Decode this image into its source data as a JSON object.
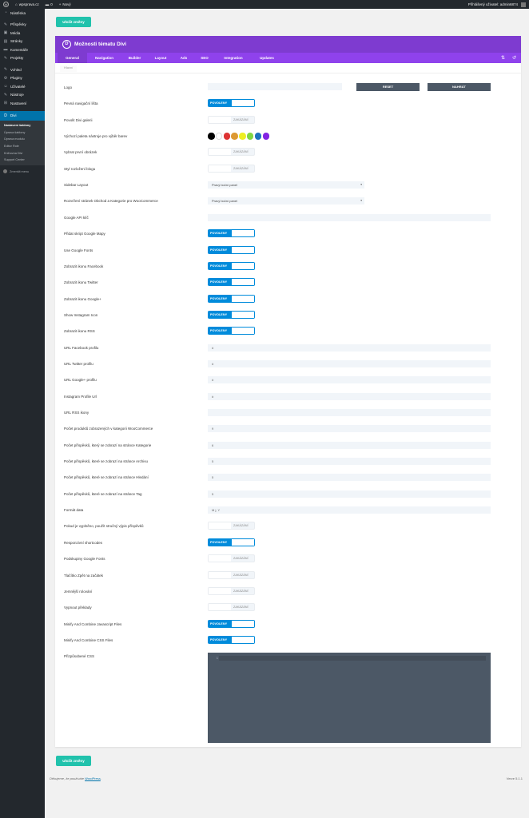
{
  "adminbar": {
    "wp_logo": "W",
    "site": "wpsprava.cz",
    "comments_count": "0",
    "new_label": "Nový",
    "greeting": "Přihlášený uživatel: admin6874"
  },
  "sidebar": {
    "menu_group1": [
      {
        "icon": "dashboard-icon",
        "glyph": "◔",
        "label": "Nástěnka"
      }
    ],
    "menu_group2": [
      {
        "icon": "pin-icon",
        "glyph": "✎",
        "label": "Příspěvky"
      },
      {
        "icon": "media-icon",
        "glyph": "▣",
        "label": "Média"
      },
      {
        "icon": "pages-icon",
        "glyph": "▤",
        "label": "Stránky"
      },
      {
        "icon": "comments-icon",
        "glyph": "▬",
        "label": "Komentáře"
      },
      {
        "icon": "projects-icon",
        "glyph": "✎",
        "label": "Projekty"
      }
    ],
    "menu_group3": [
      {
        "icon": "appearance-icon",
        "glyph": "✎",
        "label": "Vzhled"
      },
      {
        "icon": "plugins-icon",
        "glyph": "⚙",
        "label": "Pluginy"
      },
      {
        "icon": "users-icon",
        "glyph": "☺",
        "label": "Uživatelé"
      },
      {
        "icon": "tools-icon",
        "glyph": "✎",
        "label": "Nástroje"
      },
      {
        "icon": "settings-icon",
        "glyph": "⊞",
        "label": "Nastavení"
      }
    ],
    "divi": {
      "glyph": "D",
      "label": "Divi"
    },
    "submenu": [
      "Nastavení šablony",
      "Úprava šablony",
      "Úprava modulu",
      "Editor Role",
      "Knihovna Divi",
      "Support Center"
    ],
    "collapse": "Zmenšit menu"
  },
  "save_label": "Uložit změny",
  "panel": {
    "logo_letter": "D",
    "title": "Možnosti tématu Divi",
    "tabs": [
      {
        "label": "General",
        "width": 37
      },
      {
        "label": "Navigation",
        "width": 43
      },
      {
        "label": "Builder",
        "width": 33
      },
      {
        "label": "Layout",
        "width": 32
      },
      {
        "label": "Ads",
        "width": 26
      },
      {
        "label": "SEO",
        "width": 26
      },
      {
        "label": "Integration",
        "width": 46
      },
      {
        "label": "Updates",
        "width": 38
      }
    ],
    "tools": {
      "sort": "⇅",
      "reset": "↺"
    },
    "subtab": "Hlavní"
  },
  "toggle_on_label": "POVOLENY",
  "toggle_off_label": "ZAKÁZÁNÍ",
  "logo_row": {
    "label": "Logo",
    "reset": "RESET",
    "upload": "NAHRÁT"
  },
  "colors": [
    "#000000",
    "#ffffff",
    "#dd3333",
    "#dd9933",
    "#eeee22",
    "#81d742",
    "#1e73be",
    "#8224e3"
  ],
  "rows": [
    {
      "label": "Pevná navigační lišta",
      "type": "on"
    },
    {
      "label": "Povolit Divi galerii",
      "type": "off"
    },
    {
      "label": "Výchozí paleta nástroje pro výběr barev",
      "type": "colors"
    },
    {
      "label": "Vybrat první obrázek",
      "type": "off"
    },
    {
      "label": "Styl rozložení blogu",
      "type": "off"
    },
    {
      "label": "Sidebar Layout",
      "type": "select",
      "value": "Pravý boční panel"
    },
    {
      "label": "Rozvržení stránek Obchod a Kategorie pro WooCommerce",
      "type": "select",
      "value": "Pravý boční panel"
    },
    {
      "label": "Google API klíč",
      "type": "text",
      "value": ""
    },
    {
      "label": "Přidat skript Google Mapy",
      "type": "on"
    },
    {
      "label": "Use Google Fonts",
      "type": "on"
    },
    {
      "label": "Zobrazit ikonu Facebook",
      "type": "on"
    },
    {
      "label": "Zobrazit ikonu Twitter",
      "type": "on"
    },
    {
      "label": "Zobrazit ikonu Google+",
      "type": "on"
    },
    {
      "label": "Show Instagram Icon",
      "type": "on"
    },
    {
      "label": "Zobrazit ikonu RSS",
      "type": "on"
    },
    {
      "label": "URL Facebook profilu",
      "type": "text",
      "value": "#"
    },
    {
      "label": "URL Twitter profilu",
      "type": "text",
      "value": "#"
    },
    {
      "label": "URL Google+ profilu",
      "type": "text",
      "value": "#"
    },
    {
      "label": "Instagram Profile Url",
      "type": "text",
      "value": "#"
    },
    {
      "label": "URL RSS ikony",
      "type": "text",
      "value": ""
    },
    {
      "label": "Počet produktů zobrazených v kategorii WooCommerce",
      "type": "text",
      "value": "9"
    },
    {
      "label": "Počet příspěvků, který se zobrazí na stránce Kategorie",
      "type": "text",
      "value": "6"
    },
    {
      "label": "Počet příspěvků, které se zobrazí na stránce Archivu",
      "type": "text",
      "value": "5"
    },
    {
      "label": "Počet příspěvků, které se zobrazí na stránce Hledání",
      "type": "text",
      "value": "5"
    },
    {
      "label": "Počet příspěvků, které se zobrazí na stránce Tag",
      "type": "text",
      "value": "5"
    },
    {
      "label": "Formát data",
      "type": "text",
      "value": "M j, Y"
    },
    {
      "label": "Pokud je vyplněno, použít stručný výpis příspěvků",
      "type": "off"
    },
    {
      "label": "Responzivní shortcodes",
      "type": "on"
    },
    {
      "label": "Podskupiny Google Fonts",
      "type": "off"
    },
    {
      "label": "Tlačítko Zpět na začátek",
      "type": "off"
    },
    {
      "label": "Jemnější rolování",
      "type": "off"
    },
    {
      "label": "Vypnout překlady",
      "type": "off"
    },
    {
      "label": "Minify And Combine Javascript Files",
      "type": "on"
    },
    {
      "label": "Minify And Combine CSS Files",
      "type": "on"
    },
    {
      "label": "Přizpůsobené CSS",
      "type": "css",
      "line_number": "1"
    }
  ],
  "footer": {
    "thanks": "Děkujeme, že používáte ",
    "wp_link": "WordPress",
    "thanks_end": ".",
    "version": "Verze 5.1.1"
  }
}
